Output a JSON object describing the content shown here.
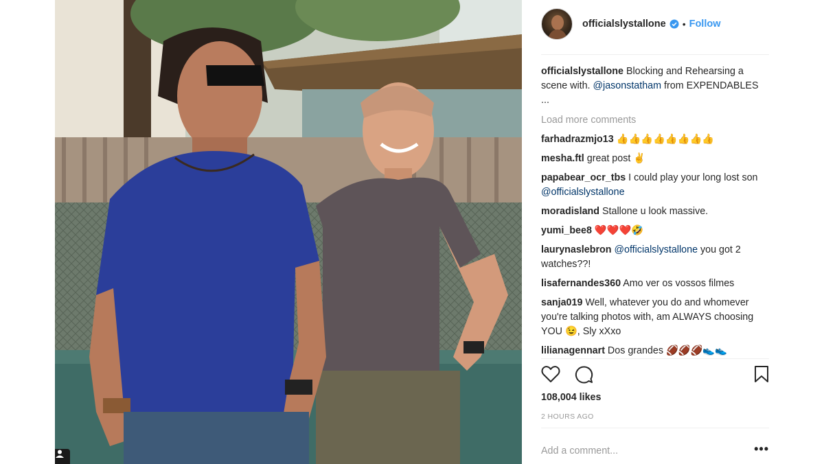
{
  "post": {
    "author": "officialslystallone",
    "follow_label": "Follow",
    "dot": "•",
    "caption_author": "officialslystallone",
    "caption_text_1": " Blocking and Rehearsing a scene with. ",
    "caption_mention": "@jasonstatham",
    "caption_text_2": " from EXPENDABLES ...",
    "load_more": "Load more comments",
    "likes": "108,004 likes",
    "time": "2 HOURS AGO",
    "add_comment_placeholder": "Add a comment...",
    "more_options": "•••"
  },
  "comments": [
    {
      "user": "farhadrazmjo13",
      "text": " 👍👍👍👍👍👍👍👍"
    },
    {
      "user": "mesha.ftl",
      "text": " great post ✌"
    },
    {
      "user": "papabear_ocr_tbs",
      "text": " I could play your long lost son ",
      "mention": "@officialslystallone"
    },
    {
      "user": "moradisland",
      "text": " Stallone u look massive."
    },
    {
      "user": "yumi_bee8",
      "text": " ❤️❤️❤️🤣"
    },
    {
      "user": "laurynaslebron",
      "pre": " ",
      "mention": "@officialslystallone",
      "text": " you got 2 watches??!"
    },
    {
      "user": "lisafernandes360",
      "text": " Amo ver os vossos filmes"
    },
    {
      "user": "sanja019",
      "text": " Well, whatever you do and whomever you're talking photos with, am ALWAYS choosing YOU 😉, Sly xXxo"
    },
    {
      "user": "lilianagennart",
      "text": " Dos grandes 🏈🏈🏈👟👟"
    }
  ],
  "icons": {
    "like": "heart-icon",
    "comment": "comment-icon",
    "save": "bookmark-icon",
    "verified": "verified-badge-icon",
    "tag": "user-tag-icon"
  },
  "colors": {
    "link": "#3897f0",
    "mention": "#003569",
    "muted": "#999999",
    "text": "#262626"
  }
}
